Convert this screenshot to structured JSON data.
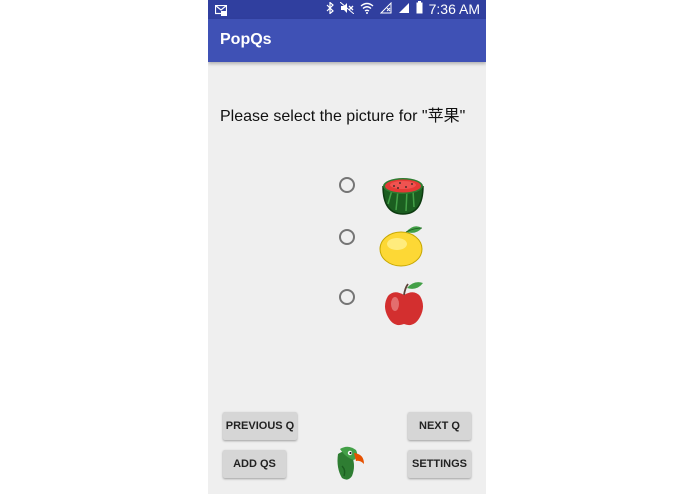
{
  "status_bar": {
    "time": "7:36 AM",
    "icons": [
      "email-icon",
      "bluetooth-icon",
      "mute-icon",
      "wifi-icon",
      "signal-no-service-icon",
      "signal-icon",
      "battery-icon"
    ]
  },
  "app_bar": {
    "title": "PopQs"
  },
  "question": {
    "text": "Please select the picture for \"苹果\""
  },
  "options": [
    {
      "fruit": "watermelon-icon",
      "selected": false
    },
    {
      "fruit": "lemon-icon",
      "selected": false
    },
    {
      "fruit": "apple-icon",
      "selected": false
    }
  ],
  "buttons": {
    "previous": "PREVIOUS Q",
    "next": "NEXT Q",
    "add": "ADD QS",
    "settings": "SETTINGS"
  },
  "colors": {
    "status_bar": "#303f9f",
    "app_bar": "#3f51b5",
    "background": "#efefef",
    "button": "#d6d6d6"
  },
  "logo": "parrot-logo-icon"
}
